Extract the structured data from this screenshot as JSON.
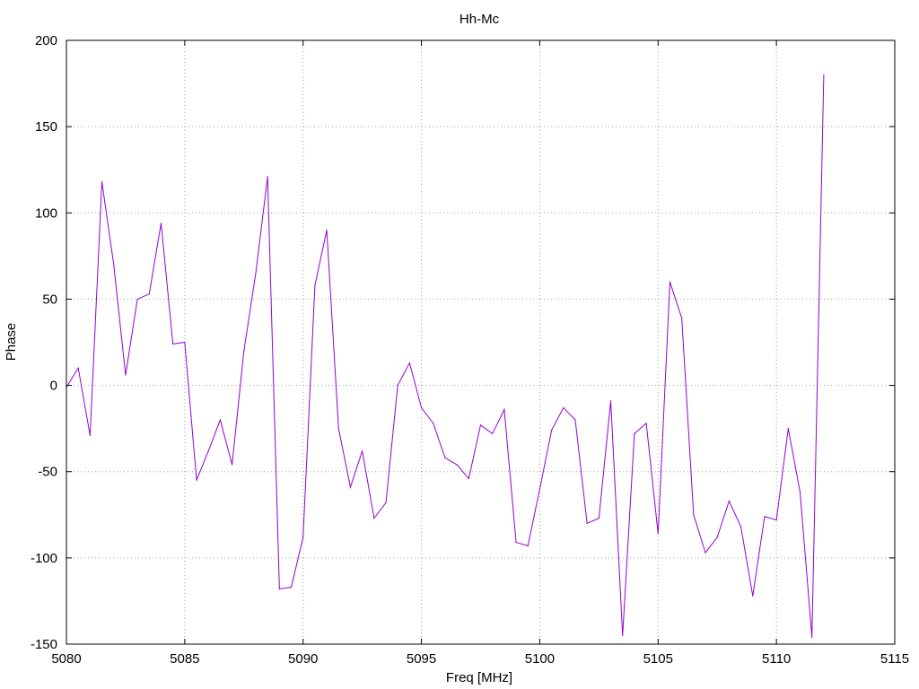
{
  "chart_data": {
    "type": "line",
    "title": "Hh-Mc",
    "xlabel": "Freq [MHz]",
    "ylabel": "Phase",
    "xlim": [
      5080,
      5115
    ],
    "ylim": [
      -150,
      200
    ],
    "xticks": [
      "5080",
      "5085",
      "5090",
      "5095",
      "5100",
      "5105",
      "5110",
      "5115"
    ],
    "yticks": [
      "-150",
      "-100",
      "-50",
      "0",
      "50",
      "100",
      "150",
      "200"
    ],
    "grid": true,
    "legend": "none",
    "series": [
      {
        "color": "#9400d3",
        "x": [
          5080,
          5080.5,
          5081,
          5081.5,
          5082,
          5082.5,
          5083,
          5083.5,
          5084,
          5084.5,
          5085,
          5085.5,
          5086,
          5086.5,
          5087,
          5087.5,
          5088,
          5088.5,
          5089,
          5089.5,
          5090,
          5090.5,
          5091,
          5091.5,
          5092,
          5092.5,
          5093,
          5093.5,
          5094,
          5094.5,
          5095,
          5095.5,
          5096,
          5096.5,
          5097,
          5097.5,
          5098,
          5098.5,
          5099,
          5099.5,
          5100,
          5100.5,
          5101,
          5101.5,
          5102,
          5102.5,
          5103,
          5103.5,
          5104,
          5104.5,
          5105,
          5105.5,
          5106,
          5106.5,
          5107,
          5107.5,
          5108,
          5108.5,
          5109,
          5109.5,
          5110,
          5110.5,
          5111,
          5111.5,
          5112
        ],
        "y": [
          -1,
          10,
          -29,
          118,
          70,
          6,
          50,
          53,
          94,
          24,
          25,
          -55,
          -38,
          -20,
          -46,
          20,
          65,
          121,
          -118,
          -117,
          -88,
          58,
          90,
          -25,
          -59,
          -38,
          -77,
          -68,
          0,
          13,
          -13,
          -22,
          -42,
          -46,
          -54,
          -23,
          -28,
          -14,
          -91,
          -93,
          -60,
          -26,
          -13,
          -20,
          -80,
          -77,
          -9,
          -145,
          -28,
          -22,
          -86,
          60,
          39,
          -75,
          -97,
          -88,
          -67,
          -82,
          -122,
          -76,
          -78,
          -25,
          -62,
          -146,
          180
        ]
      }
    ]
  }
}
